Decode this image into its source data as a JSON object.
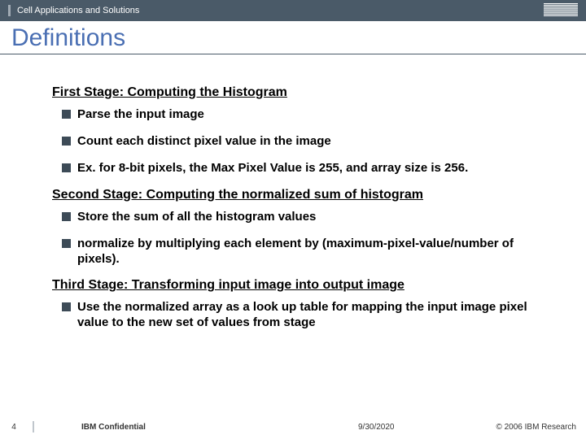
{
  "header": {
    "dept": "Cell Applications and Solutions",
    "logo": "IBM"
  },
  "title": "Definitions",
  "stage1": {
    "heading": "First Stage: Computing the Histogram",
    "b1": "Parse the input image",
    "b2": "Count each distinct pixel value in the image",
    "b3": "Ex. for 8-bit pixels, the Max Pixel Value is 255, and array size is 256."
  },
  "stage2": {
    "heading": "Second Stage: Computing the normalized sum of histogram",
    "b1": "Store the sum of all the histogram values",
    "b2": "normalize by multiplying each element by (maximum-pixel-value/number of pixels)."
  },
  "stage3": {
    "heading": "Third Stage: Transforming input image into output image",
    "b1": "Use the normalized array as a look up table for mapping the input image pixel value to the new set of values from stage"
  },
  "footer": {
    "page": "4",
    "confidential": "IBM Confidential",
    "date": "9/30/2020",
    "copyright": "© 2006 IBM Research"
  }
}
